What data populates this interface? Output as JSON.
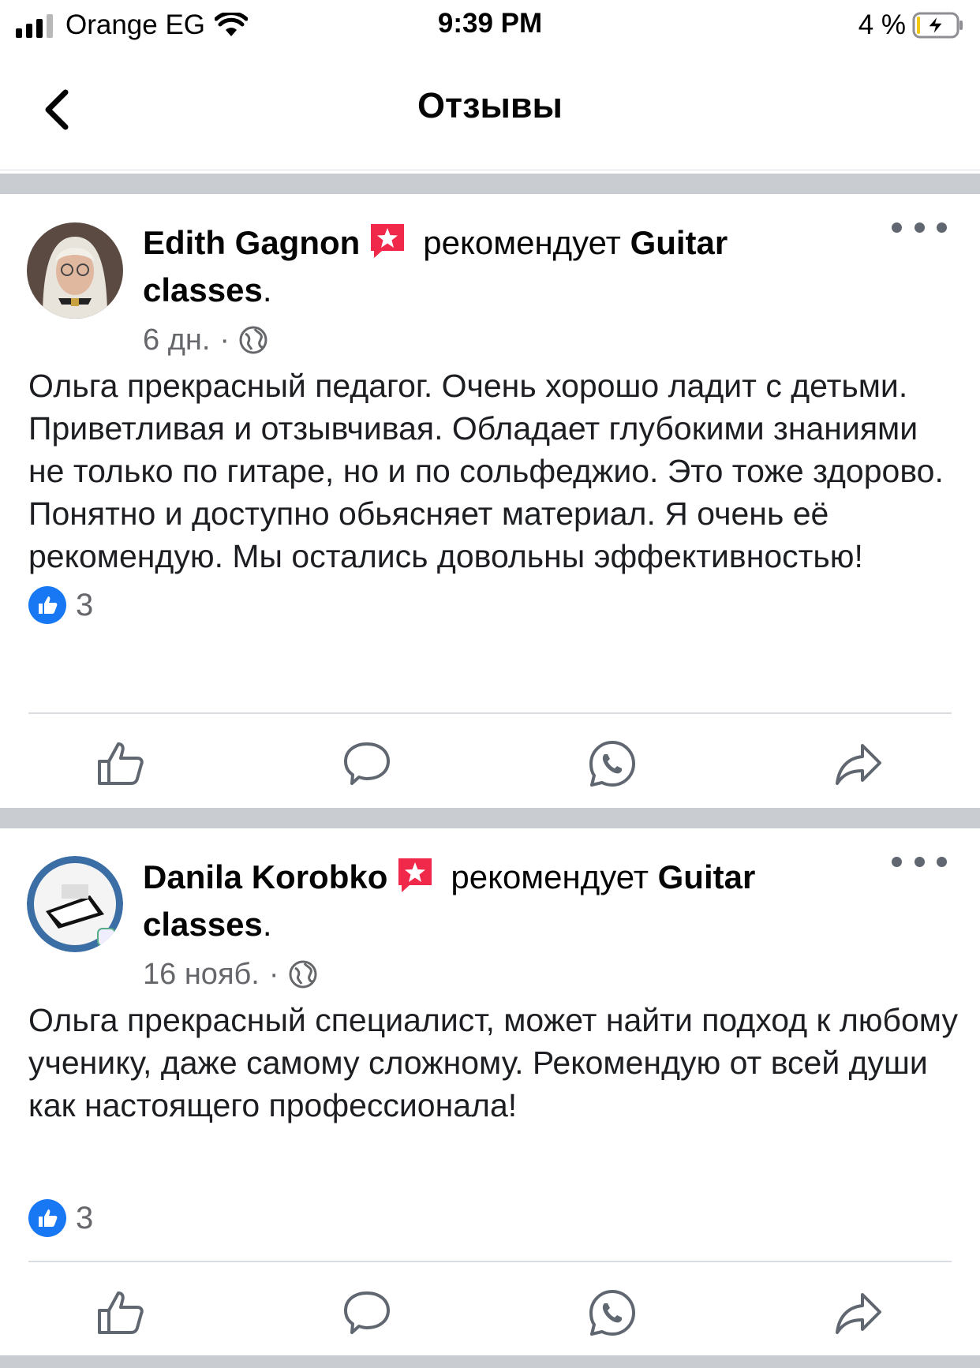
{
  "status_bar": {
    "carrier": "Orange EG",
    "time": "9:39 PM",
    "battery": "4 %"
  },
  "nav": {
    "title": "Отзывы",
    "back_icon": "chevron-left-icon"
  },
  "posts": [
    {
      "author": "Edith Gagnon",
      "verb": "рекомендует",
      "page": "Guitar classes",
      "date": "6 дн.",
      "separator": "·",
      "text": "Ольга прекрасный педагог. Очень хорошо ладит с детьми. Приветливая и отзывчивая. Обладает глубокими знаниями не только по гитаре, но и по сольфеджио. Это тоже здорово. Понятно и доступно обьясняет материал. Я очень её рекомендую. Мы остались довольны эффективностью!",
      "likes": "3"
    },
    {
      "author": "Danila Korobko",
      "verb": "рекомендует",
      "page": "Guitar classes",
      "date": "16 нояб.",
      "separator": "·",
      "text": "Ольга прекрасный специалист, может найти подход к любому ученику, даже самому сложному. Рекомендую от всей души как настоящего профессионала!",
      "likes": "3"
    }
  ],
  "actions": [
    "like-icon",
    "comment-icon",
    "whatsapp-icon",
    "share-icon"
  ],
  "colors": {
    "accent": "#1877f2",
    "badge": "#f02849",
    "separator": "#c9ccd1",
    "secondary_text": "#65676b"
  }
}
